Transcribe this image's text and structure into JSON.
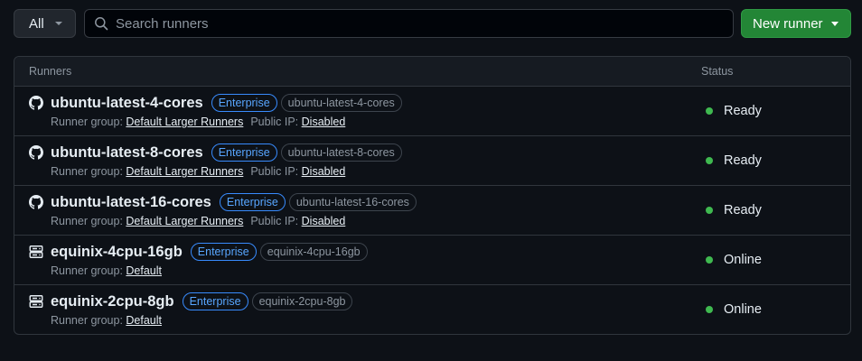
{
  "toolbar": {
    "filter_label": "All",
    "search_placeholder": "Search runners",
    "search_value": "",
    "new_runner_label": "New runner"
  },
  "table": {
    "col_runners": "Runners",
    "col_status": "Status",
    "rows": [
      {
        "icon": "github-icon",
        "name": "ubuntu-latest-4-cores",
        "badge": "Enterprise",
        "label": "ubuntu-latest-4-cores",
        "group_prefix": "Runner group:",
        "group": "Default Larger Runners",
        "ip_prefix": "Public IP:",
        "ip": "Disabled",
        "status": "Ready"
      },
      {
        "icon": "github-icon",
        "name": "ubuntu-latest-8-cores",
        "badge": "Enterprise",
        "label": "ubuntu-latest-8-cores",
        "group_prefix": "Runner group:",
        "group": "Default Larger Runners",
        "ip_prefix": "Public IP:",
        "ip": "Disabled",
        "status": "Ready"
      },
      {
        "icon": "github-icon",
        "name": "ubuntu-latest-16-cores",
        "badge": "Enterprise",
        "label": "ubuntu-latest-16-cores",
        "group_prefix": "Runner group:",
        "group": "Default Larger Runners",
        "ip_prefix": "Public IP:",
        "ip": "Disabled",
        "status": "Ready"
      },
      {
        "icon": "server-icon",
        "name": "equinix-4cpu-16gb",
        "badge": "Enterprise",
        "label": "equinix-4cpu-16gb",
        "group_prefix": "Runner group:",
        "group": "Default",
        "status": "Online"
      },
      {
        "icon": "server-icon",
        "name": "equinix-2cpu-8gb",
        "badge": "Enterprise",
        "label": "equinix-2cpu-8gb",
        "group_prefix": "Runner group:",
        "group": "Default",
        "status": "Online"
      }
    ]
  },
  "colors": {
    "background": "#0d1117",
    "accent_green": "#238636",
    "status_dot": "#3fb950",
    "enterprise_blue": "#58a6ff"
  }
}
